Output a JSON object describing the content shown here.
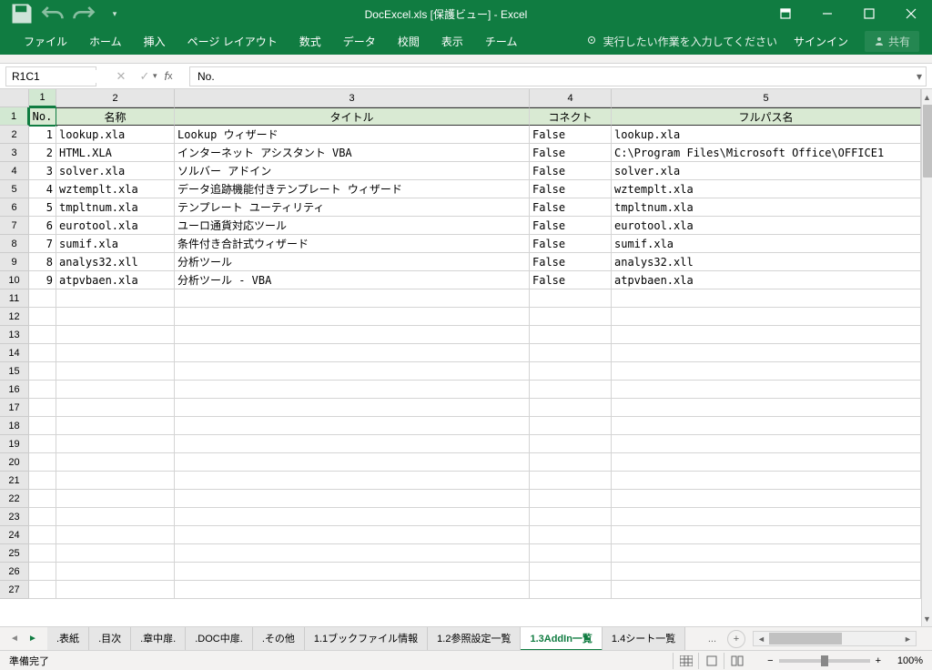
{
  "title": "DocExcel.xls  [保護ビュー] - Excel",
  "ribbon": {
    "tabs": [
      "ファイル",
      "ホーム",
      "挿入",
      "ページ レイアウト",
      "数式",
      "データ",
      "校閲",
      "表示",
      "チーム"
    ],
    "tell_me": "実行したい作業を入力してください",
    "signin": "サインイン",
    "share": "共有"
  },
  "name_box": "R1C1",
  "formula": "No.",
  "columns": [
    "1",
    "2",
    "3",
    "4",
    "5"
  ],
  "headers": [
    "No.",
    "名称",
    "タイトル",
    "コネクト",
    "フルパス名"
  ],
  "data": [
    {
      "no": "1",
      "name": "lookup.xla",
      "title": "Lookup ウィザード",
      "connect": "False",
      "path": "lookup.xla"
    },
    {
      "no": "2",
      "name": "HTML.XLA",
      "title": "インターネット アシスタント VBA",
      "connect": "False",
      "path": "C:\\Program Files\\Microsoft Office\\OFFICE1"
    },
    {
      "no": "3",
      "name": "solver.xla",
      "title": "ソルバー アドイン",
      "connect": "False",
      "path": "solver.xla"
    },
    {
      "no": "4",
      "name": "wztemplt.xla",
      "title": "データ追跡機能付きテンプレート ウィザード",
      "connect": "False",
      "path": "wztemplt.xla"
    },
    {
      "no": "5",
      "name": "tmpltnum.xla",
      "title": "テンプレート ユーティリティ",
      "connect": "False",
      "path": "tmpltnum.xla"
    },
    {
      "no": "6",
      "name": "eurotool.xla",
      "title": "ユーロ通貨対応ツール",
      "connect": "False",
      "path": "eurotool.xla"
    },
    {
      "no": "7",
      "name": "sumif.xla",
      "title": "条件付き合計式ウィザード",
      "connect": "False",
      "path": "sumif.xla"
    },
    {
      "no": "8",
      "name": "analys32.xll",
      "title": "分析ツール",
      "connect": "False",
      "path": "analys32.xll"
    },
    {
      "no": "9",
      "name": "atpvbaen.xla",
      "title": "分析ツール - VBA",
      "connect": "False",
      "path": "atpvbaen.xla"
    }
  ],
  "empty_rows": [
    11,
    12,
    13,
    14,
    15,
    16,
    17,
    18,
    19,
    20,
    21,
    22,
    23,
    24,
    25,
    26,
    27
  ],
  "sheet_tabs": [
    ".表紙",
    ".目次",
    ".章中扉.",
    ".DOC中扉.",
    ".その他",
    "1.1ブックファイル情報",
    "1.2参照設定一覧",
    "1.3AddIn一覧",
    "1.4シート一覧"
  ],
  "active_tab_index": 7,
  "tabs_more": "...",
  "status": "準備完了",
  "zoom": "100%"
}
